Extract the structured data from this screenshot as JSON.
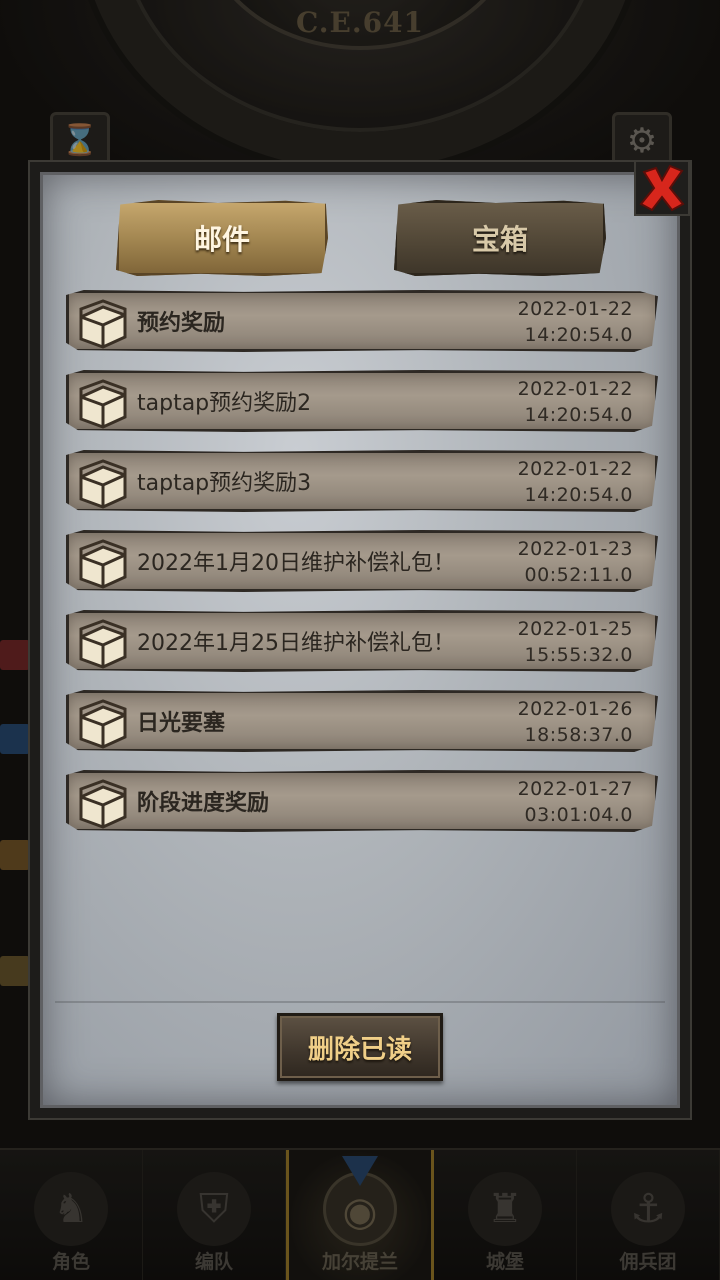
{
  "header": {
    "year_label": "C.E.641"
  },
  "panel": {
    "tabs": [
      {
        "label": "邮件",
        "active": true
      },
      {
        "label": "宝箱",
        "active": false
      }
    ],
    "mails": [
      {
        "subject": "预约奖励",
        "date": "2022-01-22",
        "time": "14:20:54.0"
      },
      {
        "subject": "taptap预约奖励2",
        "date": "2022-01-22",
        "time": "14:20:54.0"
      },
      {
        "subject": "taptap预约奖励3",
        "date": "2022-01-22",
        "time": "14:20:54.0"
      },
      {
        "subject": "2022年1月20日维护补偿礼包！",
        "date": "2022-01-23",
        "time": "00:52:11.0"
      },
      {
        "subject": "2022年1月25日维护补偿礼包！",
        "date": "2022-01-25",
        "time": "15:55:32.0"
      },
      {
        "subject": "日光要塞",
        "date": "2022-01-26",
        "time": "18:58:37.0"
      },
      {
        "subject": "阶段进度奖励",
        "date": "2022-01-27",
        "time": "03:01:04.0"
      }
    ],
    "delete_read_label": "删除已读"
  },
  "bottom_nav": [
    {
      "label": "角色",
      "icon": "knight-icon"
    },
    {
      "label": "编队",
      "icon": "helmet-icon"
    },
    {
      "label": "加尔提兰",
      "icon": "globe-icon",
      "active": true
    },
    {
      "label": "城堡",
      "icon": "castle-icon"
    },
    {
      "label": "佣兵团",
      "icon": "ship-icon"
    }
  ],
  "colors": {
    "tab_active": "#b3955c",
    "tab_inactive": "#4f4535",
    "panel_bg": "#aeb3b8",
    "close_red": "#d7261c",
    "delete_text": "#f0cf88"
  }
}
